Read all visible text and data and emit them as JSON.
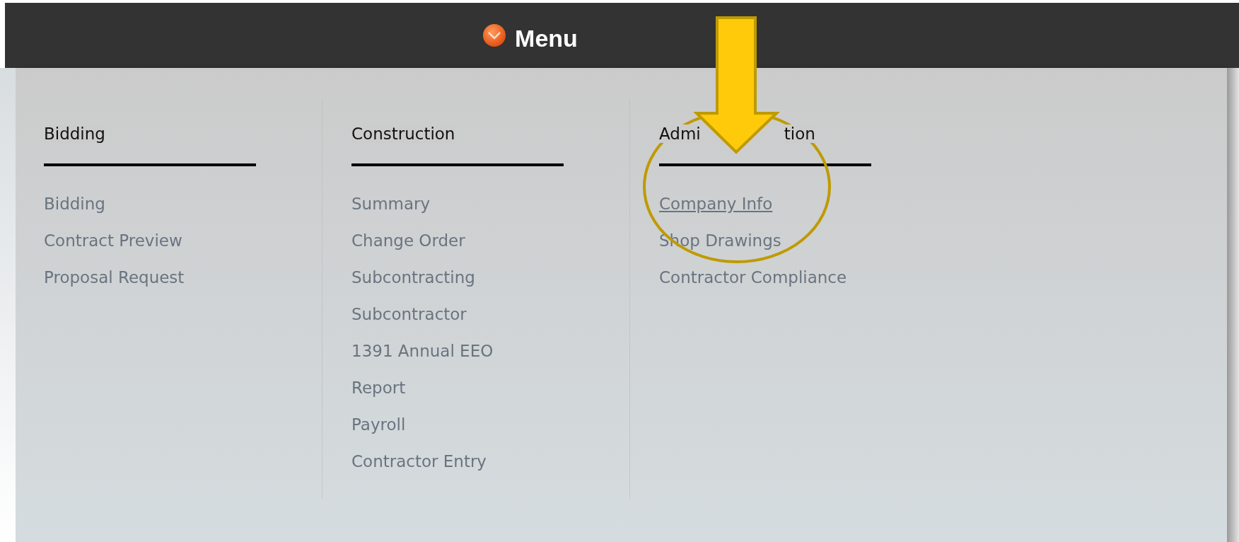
{
  "header": {
    "title": "Menu"
  },
  "columns": [
    {
      "heading": [
        "Bidding"
      ],
      "items": [
        {
          "label": "Bidding",
          "selected": false
        },
        {
          "label": "Contract Preview",
          "selected": false
        },
        {
          "label": "Proposal Request",
          "selected": false
        }
      ]
    },
    {
      "heading": [
        "Construction"
      ],
      "items": [
        {
          "label": "Summary",
          "selected": false
        },
        {
          "label": "Change Order",
          "selected": false
        },
        {
          "label": "Subcontracting",
          "selected": false
        },
        {
          "label": "Subcontractor",
          "selected": false
        },
        {
          "label": "1391 Annual EEO",
          "selected": false
        },
        {
          "label": "Report",
          "selected": false
        },
        {
          "label": "Payroll",
          "selected": false
        },
        {
          "label": "Contractor Entry",
          "selected": false
        }
      ]
    },
    {
      "heading": [
        "Admi",
        "tion"
      ],
      "items": [
        {
          "label": "Company Info",
          "selected": true
        },
        {
          "label": "Shop Drawings",
          "selected": false
        },
        {
          "label": "Contractor Compliance",
          "selected": false
        }
      ]
    }
  ]
}
